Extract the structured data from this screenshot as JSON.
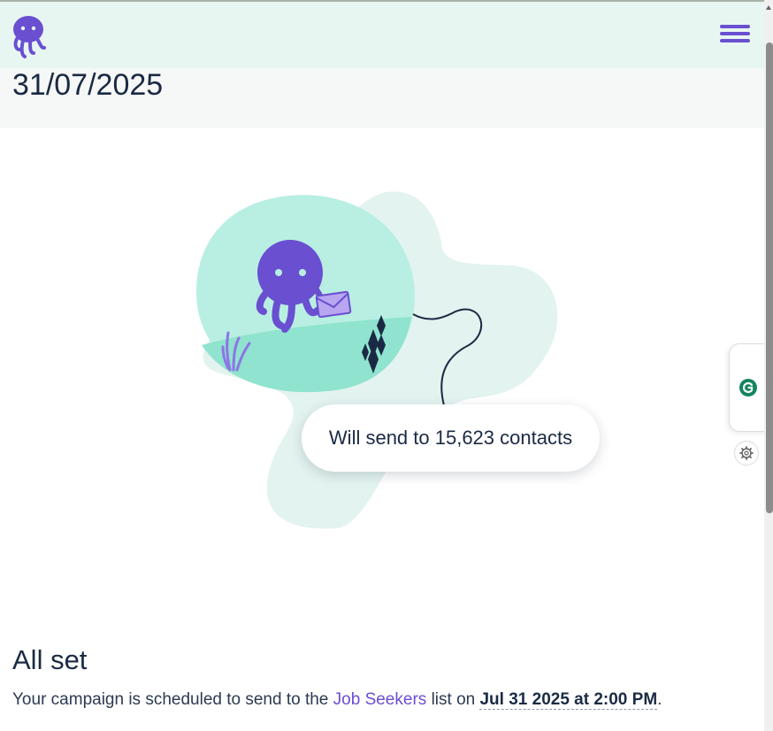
{
  "header": {
    "logo_icon": "octopus-logo-icon",
    "menu_icon": "hamburger-menu-icon"
  },
  "date": "31/07/2025",
  "illustration": {
    "bubble_text": "Will send to 15,623 contacts"
  },
  "status": {
    "title": "All set",
    "desc_before": "Your campaign is scheduled to send to the",
    "list_name": "Job Seekers",
    "desc_middle": "list on",
    "scheduled_time": "Jul 31 2025 at 2:00 PM",
    "desc_after": "."
  },
  "extension": {
    "grammarly_icon": "grammarly-icon",
    "settings_icon": "gear-icon"
  },
  "colors": {
    "brand_purple": "#6a4fd1",
    "header_bg": "#e8f6f2",
    "navy": "#1b2a44",
    "mint": "#b8efe2",
    "mint_dark": "#8fe3cf",
    "blob_light": "#e3f3ef"
  }
}
